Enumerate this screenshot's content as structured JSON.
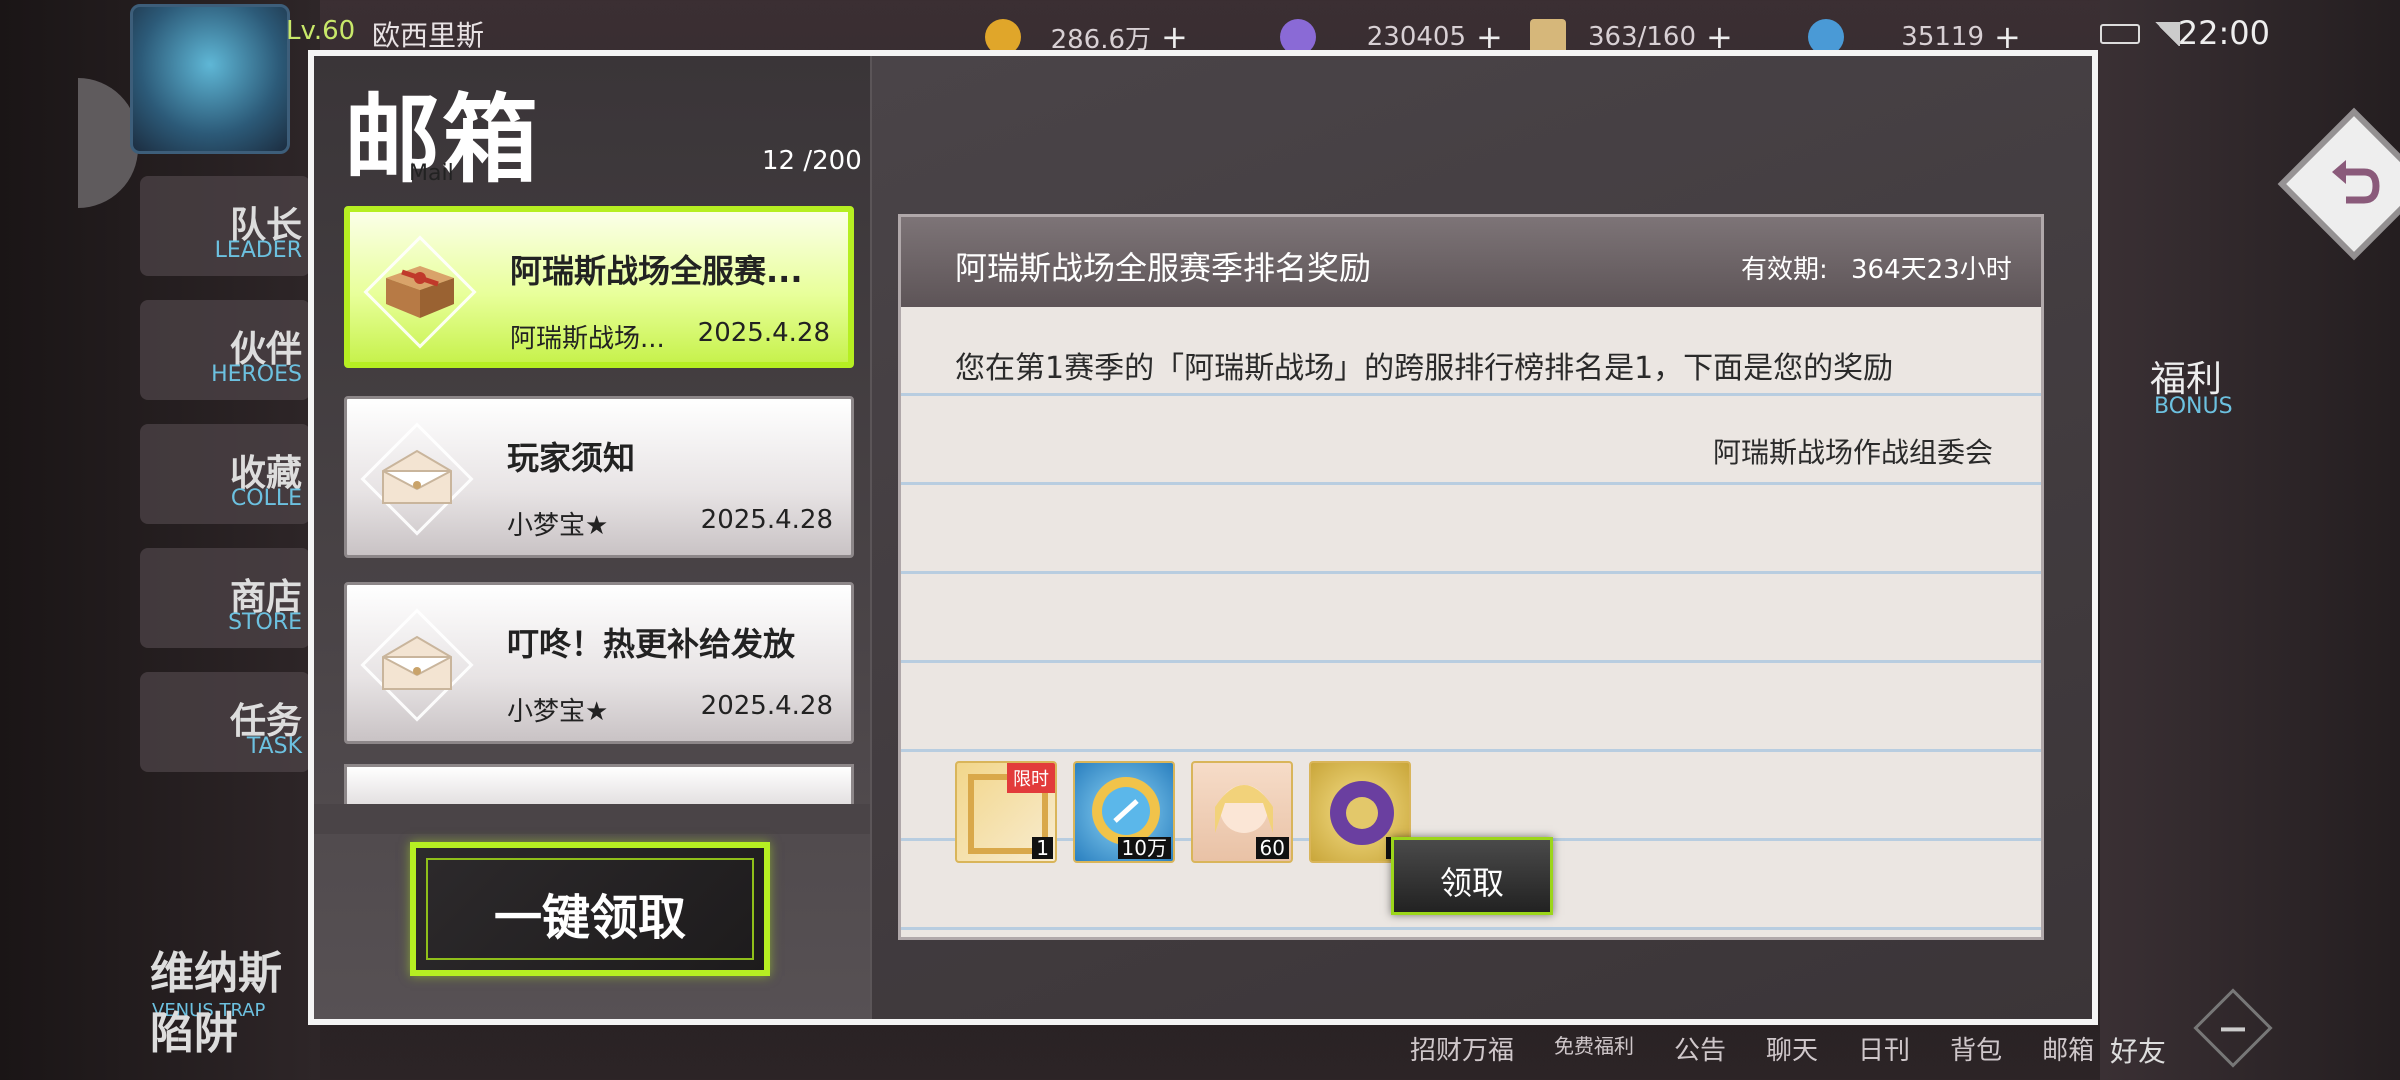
{
  "hud": {
    "level": "Lv.60",
    "player_name": "欧西里斯",
    "resources": [
      {
        "value": "286.6万",
        "color": "#e0a62a"
      },
      {
        "value": "230405",
        "color": "#8a6ad6"
      },
      {
        "value": "363/160",
        "color": "#d6b77a"
      },
      {
        "value": "35119",
        "color": "#4a9ad6"
      }
    ],
    "clock": "22:00"
  },
  "left_menu": [
    {
      "cn": "队长",
      "en": "LEADER"
    },
    {
      "cn": "伙伴",
      "en": "HEROES"
    },
    {
      "cn": "收藏",
      "en": "COLLE"
    },
    {
      "cn": "商店",
      "en": "STORE"
    },
    {
      "cn": "任务",
      "en": "TASK"
    }
  ],
  "bottom_left": {
    "label_top": "维纳斯",
    "label_bottom": "陷阱",
    "sub": "VENUS TRAP"
  },
  "right_menu": {
    "cn": "福利",
    "en": "BONUS"
  },
  "bottom_nav": [
    "招财万福",
    "免费福利",
    "公告",
    "聊天",
    "日刊",
    "背包",
    "邮箱"
  ],
  "friends": "好友",
  "mailbox": {
    "title": "邮箱",
    "subtitle": "Mail",
    "count": "12 /200",
    "claim_all": "一键领取",
    "items": [
      {
        "title": "阿瑞斯战场全服赛...",
        "from": "阿瑞斯战场...",
        "date": "2025.4.28",
        "icon": "gift-box-icon"
      },
      {
        "title": "玩家须知",
        "from": "小梦宝★",
        "date": "2025.4.28",
        "icon": "open-envelope-icon"
      },
      {
        "title": "叮咚！热更补给发放",
        "from": "小梦宝★",
        "date": "2025.4.28",
        "icon": "open-envelope-icon"
      }
    ]
  },
  "detail": {
    "title": "阿瑞斯战场全服赛季排名奖励",
    "valid_label": "有效期:",
    "valid_value": "364天23小时",
    "message": "您在第1赛季的「阿瑞斯战场」的跨服排行榜排名是1，下面是您的奖励",
    "signature": "阿瑞斯战场作战组委会",
    "rewards": [
      {
        "qty": "1",
        "badge": "限时",
        "icon": "avatar-frame-icon"
      },
      {
        "qty": "10万",
        "icon": "gold-compass-coin-icon"
      },
      {
        "qty": "60",
        "icon": "character-portrait-icon"
      },
      {
        "qty": "5",
        "icon": "purple-ring-icon"
      }
    ],
    "claim": "领取"
  }
}
